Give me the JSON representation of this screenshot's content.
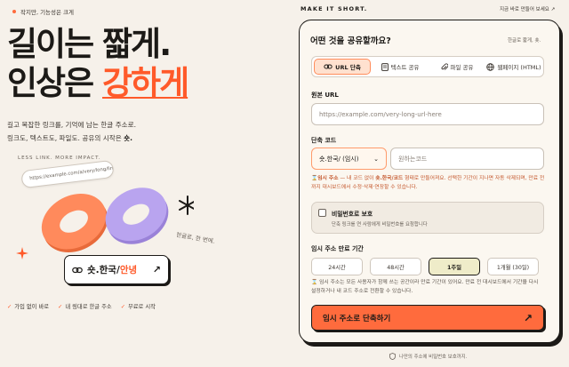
{
  "hero": {
    "tag": "작지만, 기능성은 크게",
    "line1": "길이는 짧게.",
    "line2_prefix": "인상은 ",
    "line2_accent": "강하게",
    "desc_line1": "길고 복잡한 링크를, 기억에 남는 한글 주소로.",
    "desc_line2_prefix": "링크도, 텍스트도, 파일도. 공유의 시작은 ",
    "desc_line2_bold": "숏.",
    "less_link": "LESS LINK. MORE IMPACT.",
    "sample_url": "https://example.com/a/very/long/link...",
    "caption": "한글로, 한 번에.",
    "result_prefix": "숏.한국/",
    "result_accent": "안녕",
    "features": [
      "가입 없이 바로",
      "내 링대로 한글 주소",
      "무료로 시작"
    ]
  },
  "header": {
    "slogan": "MAKE IT SHORT.",
    "top_link": "지금 바로 만들어 보세요 ↗"
  },
  "form": {
    "title": "어떤 것을 공유할까요?",
    "subtitle": "한글로 짧게, 숏.",
    "tabs": [
      {
        "label": "URL 단축",
        "icon": "link-icon",
        "active": true
      },
      {
        "label": "텍스트 공유",
        "icon": "document-icon",
        "active": false
      },
      {
        "label": "파일 공유",
        "icon": "paperclip-icon",
        "active": false
      },
      {
        "label": "웹페이지 (HTML)",
        "icon": "globe-icon",
        "active": false
      }
    ],
    "url_label": "원본 URL",
    "url_placeholder": "https://example.com/very-long-url-here",
    "short_label": "단축 코드",
    "domain_select": "숏.한국/ (임시)",
    "code_placeholder": "원하는코드",
    "note": {
      "bold": "임시 주소",
      "text1": " — 내 코드 없이 ",
      "code": "숏.한국/코드",
      "text2": " 형태로 만들어져요. 선택한 기간이 지나면 자동 삭제되며, 만료 전까지 대시보드에서 수정·삭제·연장할 수 있습니다."
    },
    "password": {
      "title": "비밀번호로 보호",
      "desc": "단축 링크를 연 사람에게 비밀번호를 요청합니다"
    },
    "expiry_label": "임시 주소 만료 기간",
    "expiry_options": [
      {
        "label": "24시간",
        "active": false
      },
      {
        "label": "48시간",
        "active": false
      },
      {
        "label": "1주일",
        "active": true
      },
      {
        "label": "1개월 (30일)",
        "active": false
      }
    ],
    "expiry_note": "임시 주소는 모든 사용자가 함께 쓰는 공간이라 만료 기간이 있어요. 만료 전 대시보드에서 기간을 다시 설정하거나 내 코드 주소로 전환할 수 있습니다.",
    "submit_label": "임시 주소로 단축하기",
    "footer_note": "나만의 주소에 비밀번호 보호까지."
  },
  "colors": {
    "accent": "#ff6b3d",
    "background": "#f6f1ea",
    "ring_orange": "#ff8a5c",
    "ring_purple": "#b9a4ef"
  }
}
